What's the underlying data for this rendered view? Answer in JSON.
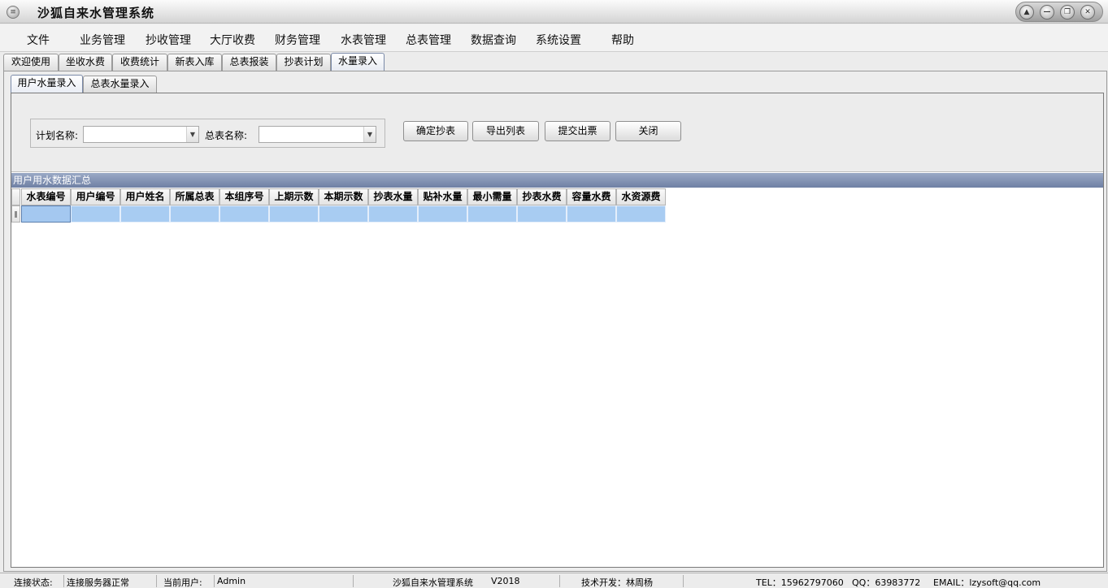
{
  "window": {
    "title": "沙狐自来水管理系统",
    "icon_glyph": "≡",
    "controls": [
      "▲",
      "—",
      "❐",
      "✕"
    ]
  },
  "menu": [
    "文件",
    "业务管理",
    "抄收管理",
    "大厅收费",
    "财务管理",
    "水表管理",
    "总表管理",
    "数据查询",
    "系统设置",
    "帮助"
  ],
  "main_tabs": [
    "欢迎使用",
    "坐收水费",
    "收费统计",
    "新表入库",
    "总表报装",
    "抄表计划",
    "水量录入"
  ],
  "main_tabs_active": 6,
  "sub_tabs": [
    "用户水量录入",
    "总表水量录入"
  ],
  "sub_tabs_active": 0,
  "filter": {
    "plan_label": "计划名称:",
    "plan_value": "",
    "master_label": "总表名称:",
    "master_value": ""
  },
  "buttons": [
    "确定抄表",
    "导出列表",
    "提交出票",
    "关闭"
  ],
  "section_title": "用户用水数据汇总",
  "table": {
    "columns": [
      "水表编号",
      "用户编号",
      "用户姓名",
      "所属总表",
      "本组序号",
      "上期示数",
      "本期示数",
      "抄表水量",
      "贴补水量",
      "最小需量",
      "抄表水费",
      "容量水费",
      "水资源费"
    ],
    "rows": [
      [
        "",
        "",
        "",
        "",
        "",
        "",
        "",
        "",
        "",
        "",
        "",
        "",
        ""
      ]
    ]
  },
  "status": {
    "conn_label": "连接状态:",
    "conn_value": "连接服务器正常",
    "user_label": "当前用户:",
    "user_value": "Admin",
    "app_name": "沙狐自来水管理系统",
    "version": "V2018",
    "dev": "技术开发：林周杨",
    "tel": "TEL：15962797060",
    "qq": "QQ：63983772",
    "email": "EMAIL：lzysoft@qq.com"
  },
  "colors": {
    "accent": "#6f80a4",
    "selection": "#a8ccf2"
  }
}
